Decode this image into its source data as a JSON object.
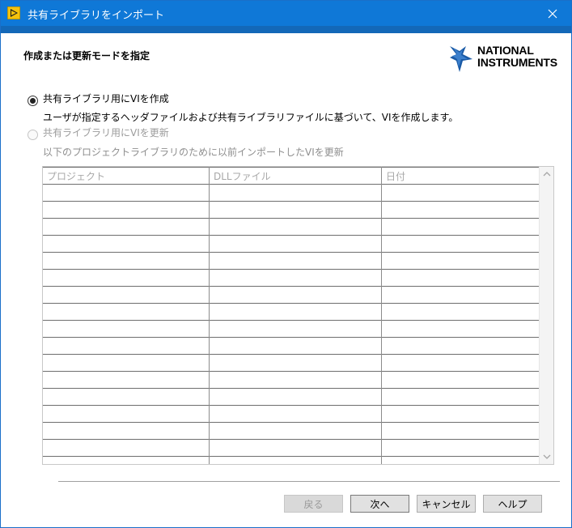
{
  "window": {
    "title": "共有ライブラリをインポート",
    "title_bar_color": "#0f78d7",
    "header_strip_color": "#1368b8"
  },
  "page": {
    "heading": "作成または更新モードを指定"
  },
  "logo": {
    "line1": "NATIONAL",
    "line2": "INSTRUMENTS",
    "icon": "ni-eagle-logo",
    "brand_color": "#1a5aa6"
  },
  "options": [
    {
      "label": "共有ライブラリ用にVIを作成",
      "description": "ユーザが指定するヘッダファイルおよび共有ライブラリファイルに基づいて、VIを作成します。",
      "selected": true,
      "enabled": true
    },
    {
      "label": "共有ライブラリ用にVIを更新",
      "description": "以下のプロジェクトライブラリのために以前インポートしたVIを更新",
      "selected": false,
      "enabled": false
    }
  ],
  "table": {
    "columns": [
      "プロジェクト",
      "DLLファイル",
      "日付"
    ],
    "rows": []
  },
  "buttons": {
    "back": "戻る",
    "next": "次へ",
    "cancel": "キャンセル",
    "help": "ヘルプ"
  }
}
